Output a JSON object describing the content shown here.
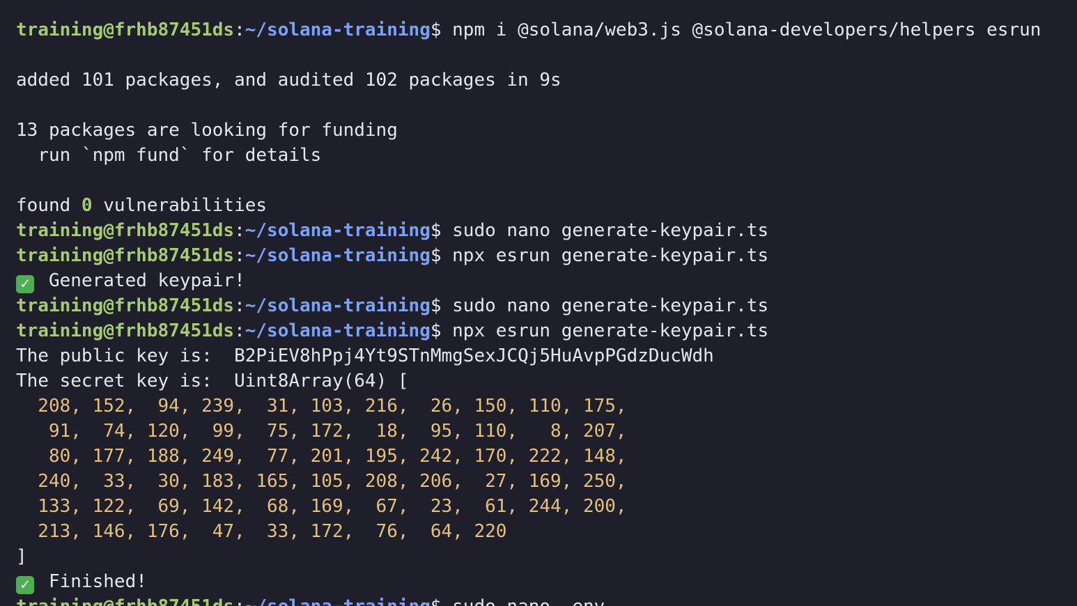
{
  "prompt": {
    "user": "training@frhb87451ds",
    "colon": ":",
    "path": "~/solana-training",
    "dollar": "$ "
  },
  "commands": [
    "npm i @solana/web3.js @solana-developers/helpers esrun",
    "sudo nano generate-keypair.ts",
    "npx esrun generate-keypair.ts",
    "sudo nano generate-keypair.ts",
    "npx esrun generate-keypair.ts",
    "sudo nano .env"
  ],
  "npm_output": {
    "added": "added 101 packages, and audited 102 packages in 9s",
    "funding": "13 packages are looking for funding",
    "fund_hint": "  run `npm fund` for details",
    "found_prefix": "found ",
    "found_count": "0",
    "found_suffix": " vulnerabilities"
  },
  "emoji": {
    "check_icon": "check-mark-button",
    "check_color": "#4caf50"
  },
  "script_output": {
    "generated": "Generated keypair!",
    "public_key_label": "The public key is:  ",
    "public_key": "B2PiEV8hPpj4Yt9STnMmgSexJCQj5HuAvpPGdzDucWdh",
    "secret_key_label": "The secret key is:  ",
    "secret_key_open": "Uint8Array(64) [",
    "secret_key_rows": [
      "  208, 152,  94, 239,  31, 103, 216,  26, 150, 110, 175,",
      "   91,  74, 120,  99,  75, 172,  18,  95, 110,   8, 207,",
      "   80, 177, 188, 249,  77, 201, 195, 242, 170, 222, 148,",
      "  240,  33,  30, 183, 165, 105, 208, 206,  27, 169, 250,",
      "  133, 122,  69, 142,  68, 169,  67,  23,  61, 244, 200,",
      "  213, 146, 176,  47,  33, 172,  76,  64, 220"
    ],
    "secret_key_close": "]",
    "finished": "Finished!"
  },
  "colors": {
    "background": "#1e1f2b",
    "text": "#e6e6ef",
    "user": "#a6cc70",
    "path": "#7aa2f7",
    "number": "#e5c07b"
  }
}
